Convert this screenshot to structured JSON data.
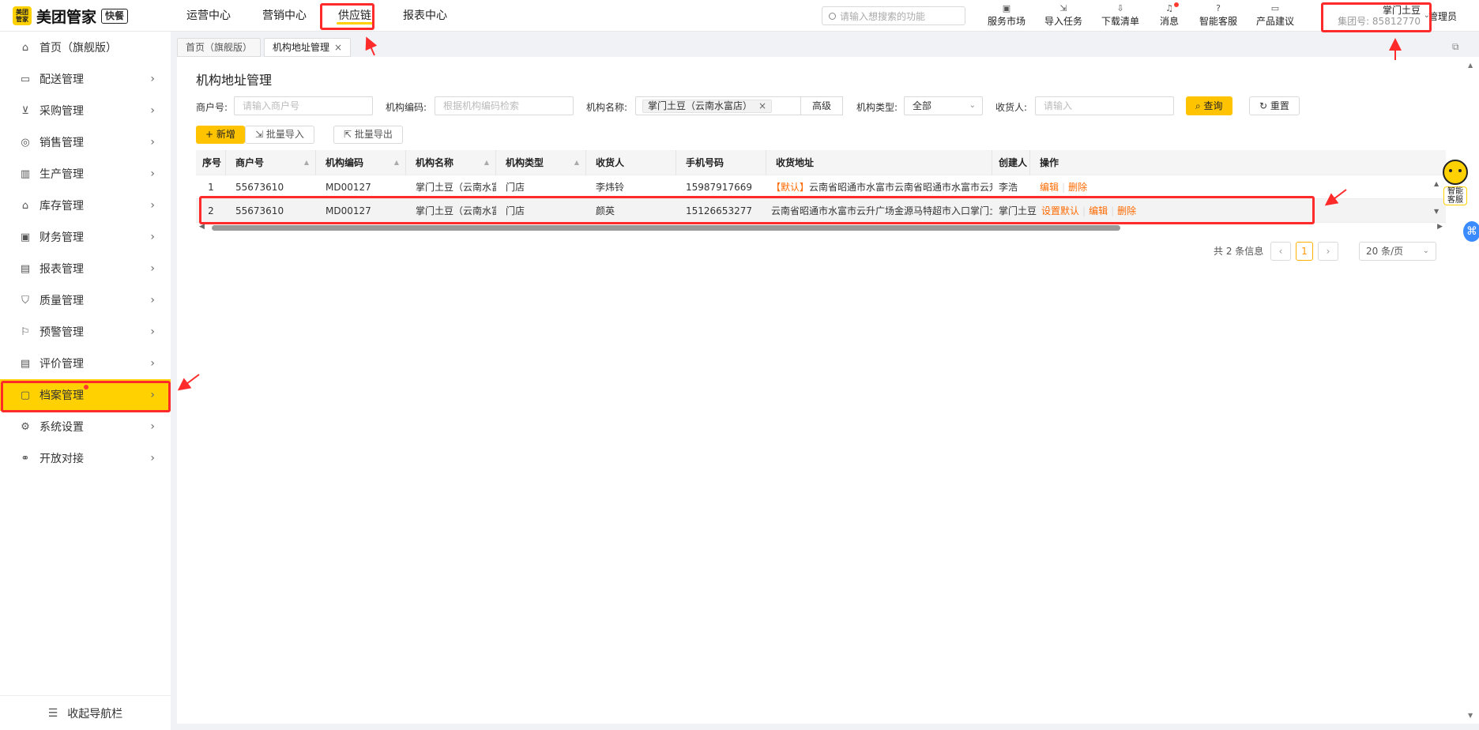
{
  "app": {
    "logo_mark": "美团\n管家",
    "logo_text": "美团管家",
    "logo_tag": "快餐"
  },
  "topnav": [
    {
      "label": "运营中心"
    },
    {
      "label": "营销中心"
    },
    {
      "label": "供应链"
    },
    {
      "label": "报表中心"
    }
  ],
  "search": {
    "placeholder": "请输入想搜索的功能"
  },
  "tools": [
    {
      "label": "服务市场",
      "icon": "shop-icon"
    },
    {
      "label": "导入任务",
      "icon": "import-icon"
    },
    {
      "label": "下载清单",
      "icon": "download-icon"
    },
    {
      "label": "消息",
      "icon": "bell-icon"
    },
    {
      "label": "智能客服",
      "icon": "question-icon"
    },
    {
      "label": "产品建议",
      "icon": "feedback-icon"
    }
  ],
  "org": {
    "name": "掌门土豆",
    "id": "集团号: 85812770"
  },
  "admin": "管理员",
  "sidebar": {
    "items": [
      {
        "label": "首页（旗舰版）"
      },
      {
        "label": "配送管理"
      },
      {
        "label": "采购管理"
      },
      {
        "label": "销售管理"
      },
      {
        "label": "生产管理"
      },
      {
        "label": "库存管理"
      },
      {
        "label": "财务管理"
      },
      {
        "label": "报表管理"
      },
      {
        "label": "质量管理"
      },
      {
        "label": "预警管理"
      },
      {
        "label": "评价管理"
      },
      {
        "label": "档案管理"
      },
      {
        "label": "系统设置"
      },
      {
        "label": "开放对接"
      }
    ],
    "collapse_label": "收起导航栏"
  },
  "tabs": [
    {
      "label": "首页（旗舰版）"
    },
    {
      "label": "机构地址管理"
    }
  ],
  "main": {
    "title": "机构地址管理",
    "filters": {
      "merchant_label": "商户号:",
      "merchant_placeholder": "请输入商户号",
      "code_label": "机构编码:",
      "code_placeholder": "根据机构编码检索",
      "name_label": "机构名称:",
      "name_chip": "掌门土豆（云南水富店）",
      "advanced": "高级",
      "type_label": "机构类型:",
      "type_value": "全部",
      "receiver_label": "收货人:",
      "receiver_placeholder": "请输入",
      "query": "查询",
      "reset": "重置"
    },
    "actions": {
      "add": "新增",
      "import": "批量导入",
      "export": "批量导出"
    },
    "table": {
      "headers": [
        "序号",
        "商户号",
        "机构编码",
        "机构名称",
        "机构类型",
        "收货人",
        "手机号码",
        "收货地址",
        "创建人",
        "操作"
      ],
      "rows": [
        {
          "no": "1",
          "merchant": "55673610",
          "code": "MD00127",
          "name": "掌门土豆（云南水富...",
          "type": "门店",
          "receiver": "李炜铃",
          "phone": "15987917669",
          "default_tag": "【默认】",
          "address": "云南省昭通市水富市云南省昭通市水富市云升广场金源马",
          "creator": "李浩",
          "ops": [
            "编辑",
            "删除"
          ]
        },
        {
          "no": "2",
          "merchant": "55673610",
          "code": "MD00127",
          "name": "掌门土豆（云南水富...",
          "type": "门店",
          "receiver": "颜英",
          "phone": "15126653277",
          "default_tag": "",
          "address": "云南省昭通市水富市云升广场金源马特超市入口掌门土豆",
          "creator": "掌门土豆",
          "ops": [
            "设置默认",
            "编辑",
            "删除"
          ]
        }
      ]
    },
    "pagination": {
      "total": "共 2 条信息",
      "current": "1",
      "page_size": "20 条/页"
    }
  },
  "assistant_label": "智能客服",
  "colors": {
    "accent": "#ffd100",
    "button": "#ffc300",
    "link": "#ff6a00",
    "annotation": "#ff2b2b"
  }
}
